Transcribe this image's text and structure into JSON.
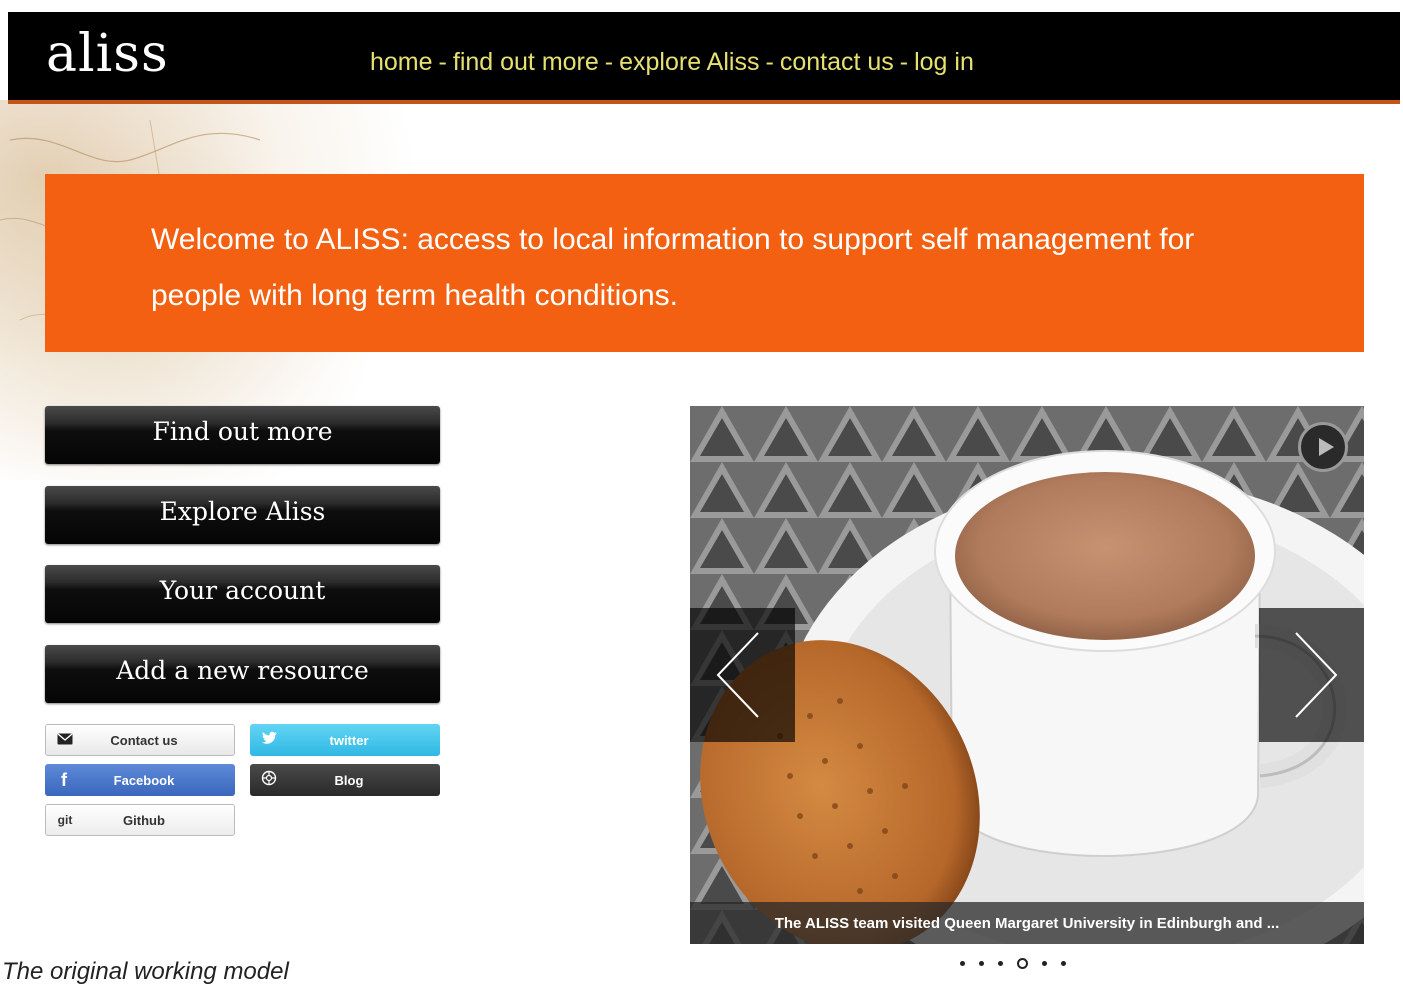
{
  "header": {
    "logo": "aliss",
    "nav": [
      {
        "label": "home"
      },
      {
        "label": "find out more"
      },
      {
        "label": "explore Aliss"
      },
      {
        "label": "contact us"
      },
      {
        "label": "log in"
      }
    ],
    "separator": "-"
  },
  "banner": {
    "text": "Welcome to ALISS: access to local information to support self management for people with long term health conditions."
  },
  "menu": [
    {
      "label": "Find out more"
    },
    {
      "label": "Explore Aliss"
    },
    {
      "label": "Your account"
    },
    {
      "label": "Add a new resource"
    }
  ],
  "social": {
    "contact": {
      "label": "Contact us",
      "icon": "envelope-icon"
    },
    "twitter": {
      "label": "twitter",
      "icon": "twitter-bird-icon"
    },
    "facebook": {
      "label": "Facebook",
      "icon": "facebook-f-icon",
      "glyph": "f"
    },
    "blog": {
      "label": "Blog",
      "icon": "blog-icon"
    },
    "github": {
      "label": "Github",
      "icon": "git-icon",
      "glyph": "git"
    }
  },
  "slider": {
    "caption": "The ALISS team visited Queen Margaret University in Edinburgh and ...",
    "dot_count": 6,
    "active_dot": 3
  },
  "footnote": "The original working model",
  "colors": {
    "header_bg": "#000000",
    "nav_text": "#e6e070",
    "banner_bg": "#f36011",
    "header_rule": "#c4541a"
  }
}
